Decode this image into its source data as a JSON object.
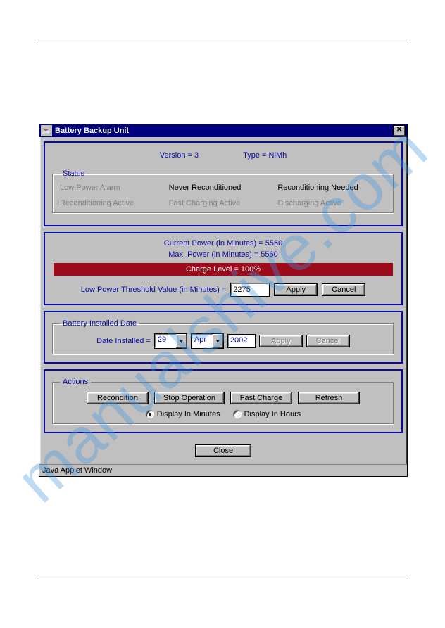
{
  "watermark": "manualshive.com",
  "window": {
    "title": "Battery Backup Unit",
    "close_glyph": "✕",
    "statusbar": "Java Applet Window"
  },
  "header": {
    "version": "Version = 3",
    "type": "Type = NiMh"
  },
  "status": {
    "legend": "Status",
    "items": {
      "low_power_alarm": "Low Power Alarm",
      "never_reconditioned": "Never Reconditioned",
      "reconditioning_needed": "Reconditioning Needed",
      "reconditioning_active": "Reconditioning Active",
      "fast_charging_active": "Fast Charging Active",
      "discharging_active": "Discharging Active"
    }
  },
  "power": {
    "current": "Current Power (in Minutes) = 5560",
    "max": "Max. Power (in Minutes) = 5560",
    "charge_level": "Charge Level = 100%"
  },
  "threshold": {
    "label": "Low Power Threshold Value (in Minutes) =",
    "value": "2275",
    "apply": "Apply",
    "cancel": "Cancel"
  },
  "battery_date": {
    "legend": "Battery Installed Date",
    "label": "Date Installed =",
    "day": "29",
    "month": "Apr",
    "year": "2002",
    "apply": "Apply",
    "cancel": "Cancel"
  },
  "actions": {
    "legend": "Actions",
    "recondition": "Recondition",
    "stop": "Stop Operation",
    "fast_charge": "Fast Charge",
    "refresh": "Refresh",
    "display_minutes": "Display In Minutes",
    "display_hours": "Display In Hours"
  },
  "close": "Close"
}
